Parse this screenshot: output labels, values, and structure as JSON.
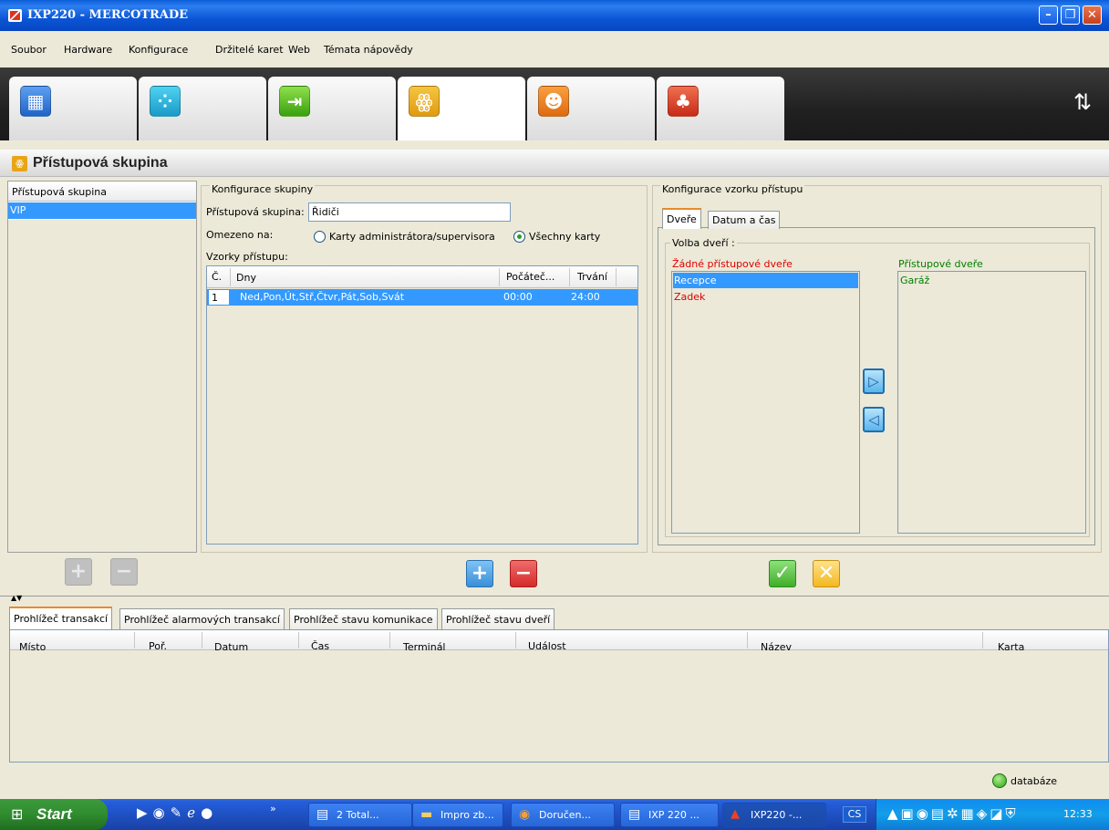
{
  "window": {
    "title": "IXP220 - MERCOTRADE"
  },
  "menu": [
    "Soubor",
    "Hardware",
    "Konfigurace",
    "Držitelé karet",
    "Web",
    "Témata nápovědy"
  ],
  "section": {
    "title": "Přístupová skupina"
  },
  "groups_list": {
    "header": "Přístupová skupina",
    "items": [
      "VIP"
    ]
  },
  "group_config": {
    "title": "Konfigurace skupiny",
    "name_label": "Přístupová skupina:",
    "name_value": "Řidiči",
    "restrict_label": "Omezeno na:",
    "radio_admin": "Karty administrátora/supervisora",
    "radio_all": "Všechny karty",
    "patterns_label": "Vzorky přístupu:",
    "columns": [
      "Č.",
      "Dny",
      "Počáteč...",
      "Trvání"
    ],
    "rows": [
      {
        "no": "1",
        "days": "Ned,Pon,Út,Stř,Čtvr,Pát,Sob,Svát",
        "start": "00:00",
        "duration": "24:00"
      }
    ]
  },
  "pattern_config": {
    "title": "Konfigurace vzorku přístupu",
    "tabs": [
      "Dveře",
      "Datum a čas"
    ],
    "door_group": "Volba dveří :",
    "no_access_label": "Žádné přístupové dveře",
    "no_access_items": [
      "Recepce",
      "Zadek"
    ],
    "access_label": "Přístupové dveře",
    "access_items": [
      "Garáž"
    ]
  },
  "bottom_tabs": [
    "Prohlížeč transakcí",
    "Prohlížeč alarmových transakcí",
    "Prohlížeč stavu komunikace",
    "Prohlížeč stavu dveří"
  ],
  "transactions": {
    "columns": [
      "Místo",
      "Poř.",
      "Datum",
      "Čas",
      "Terminál",
      "Událost",
      "Název",
      "Karta"
    ]
  },
  "status": {
    "db_label": "databáze"
  },
  "taskbar": {
    "start": "Start",
    "buttons": [
      "2 Total...",
      "Impro zb...",
      "Doručen...",
      "IXP 220 ...",
      "IXP220 -..."
    ],
    "lang": "CS",
    "clock": "12:33"
  },
  "colors": {
    "title_blue": "#0b56d6",
    "selection": "#3399ff",
    "no_access_red": "#e00000",
    "access_green": "#008000"
  }
}
